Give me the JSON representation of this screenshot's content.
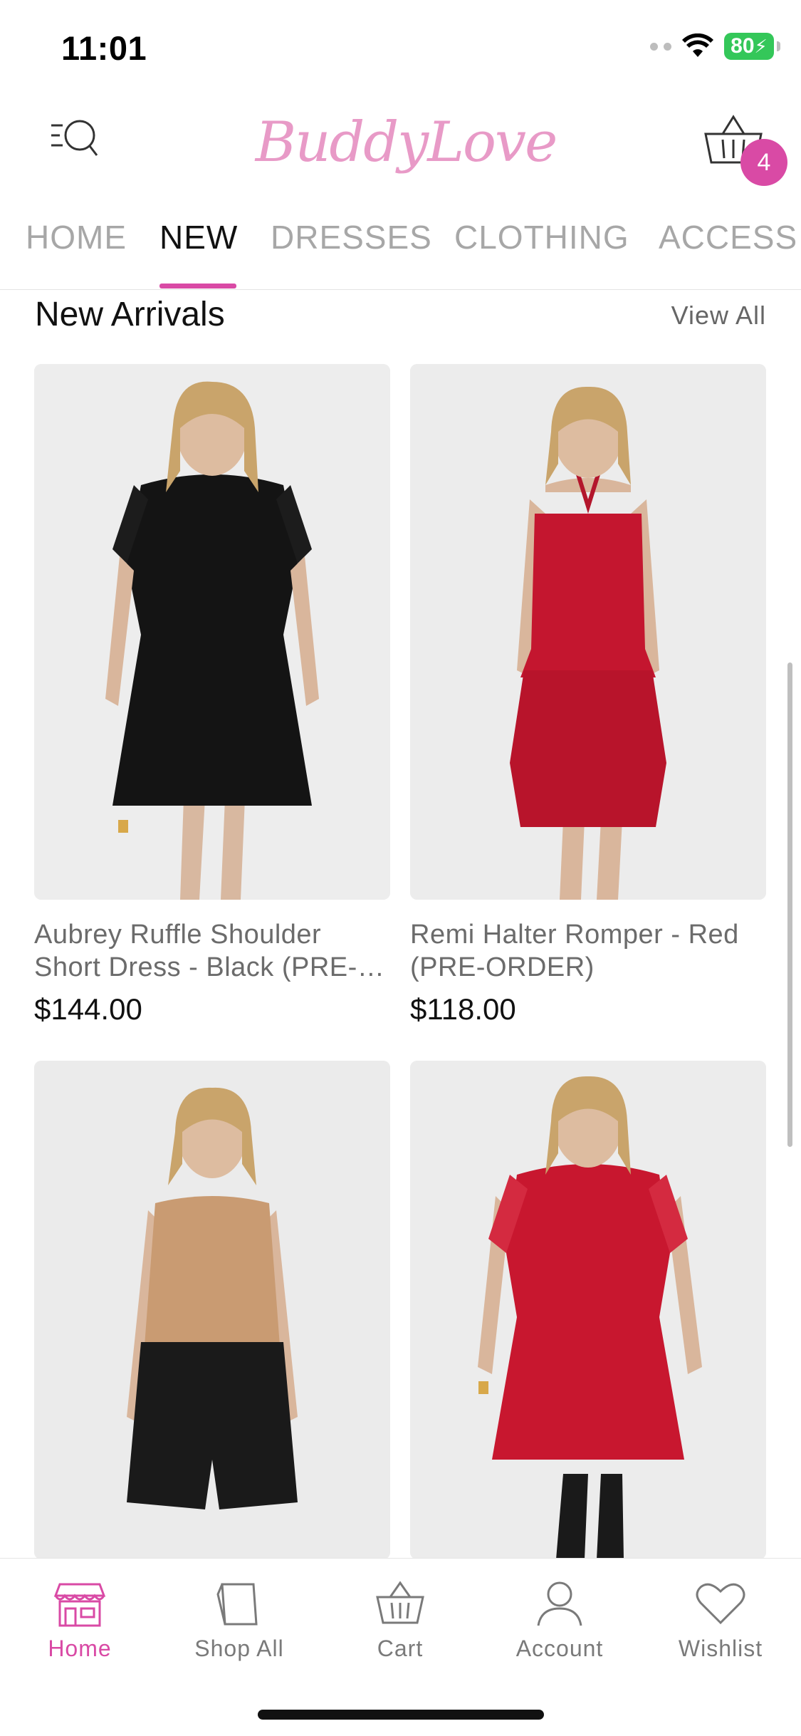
{
  "status": {
    "time": "11:01",
    "battery": "80"
  },
  "header": {
    "logo": "BuddyLove",
    "cart_count": "4"
  },
  "tabs": [
    {
      "label": "HOME"
    },
    {
      "label": "NEW"
    },
    {
      "label": "DRESSES"
    },
    {
      "label": "CLOTHING"
    },
    {
      "label": "ACCESS"
    }
  ],
  "active_tab": "NEW",
  "section": {
    "title": "New Arrivals",
    "view_all": "View All"
  },
  "products": [
    {
      "name": "Aubrey Ruffle Shoulder Short Dress - Black (PRE-ORDER)",
      "price": "$144.00"
    },
    {
      "name": "Remi Halter Romper - Red (PRE-ORDER)",
      "price": "$118.00"
    },
    {
      "name": "",
      "price": ""
    },
    {
      "name": "",
      "price": ""
    }
  ],
  "bottom_nav": [
    {
      "label": "Home",
      "icon": "storefront-icon"
    },
    {
      "label": "Shop All",
      "icon": "shopping-bag-icon"
    },
    {
      "label": "Cart",
      "icon": "basket-icon"
    },
    {
      "label": "Account",
      "icon": "person-icon"
    },
    {
      "label": "Wishlist",
      "icon": "heart-icon"
    }
  ],
  "colors": {
    "accent": "#d94aa5",
    "logo": "#e89ac7",
    "battery": "#34c759"
  }
}
